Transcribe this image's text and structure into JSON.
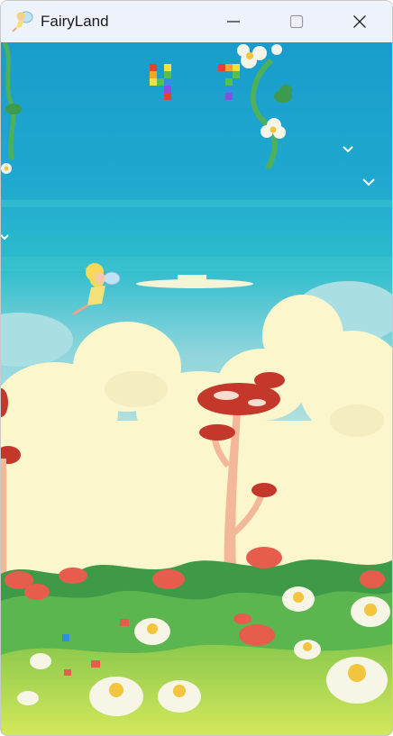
{
  "window": {
    "title": "FairyLand",
    "icon": "fairy-icon",
    "controls": [
      "minimize-icon",
      "maximize-icon",
      "close-icon"
    ]
  },
  "hud": {
    "score": {
      "digits": [
        "4",
        "7"
      ],
      "style": "rainbow-pixel"
    }
  },
  "scene": {
    "player": "fairy",
    "elements": [
      "sky",
      "clouds",
      "vines",
      "mushrooms",
      "flower-meadow",
      "birds"
    ]
  },
  "colors": {
    "sky_top": "#1ba3cc",
    "sky_mid": "#27b9ce",
    "cloud": "#fbf6cc",
    "mushroom_cap": "#c4372b",
    "mushroom_stem": "#f3b79a",
    "grass": "#4fa74a",
    "ground": "#c9e25b",
    "rainbow": [
      "#e8412f",
      "#f5a623",
      "#f6e13a",
      "#54c24a",
      "#2f8fe8",
      "#8c4ee0"
    ]
  }
}
